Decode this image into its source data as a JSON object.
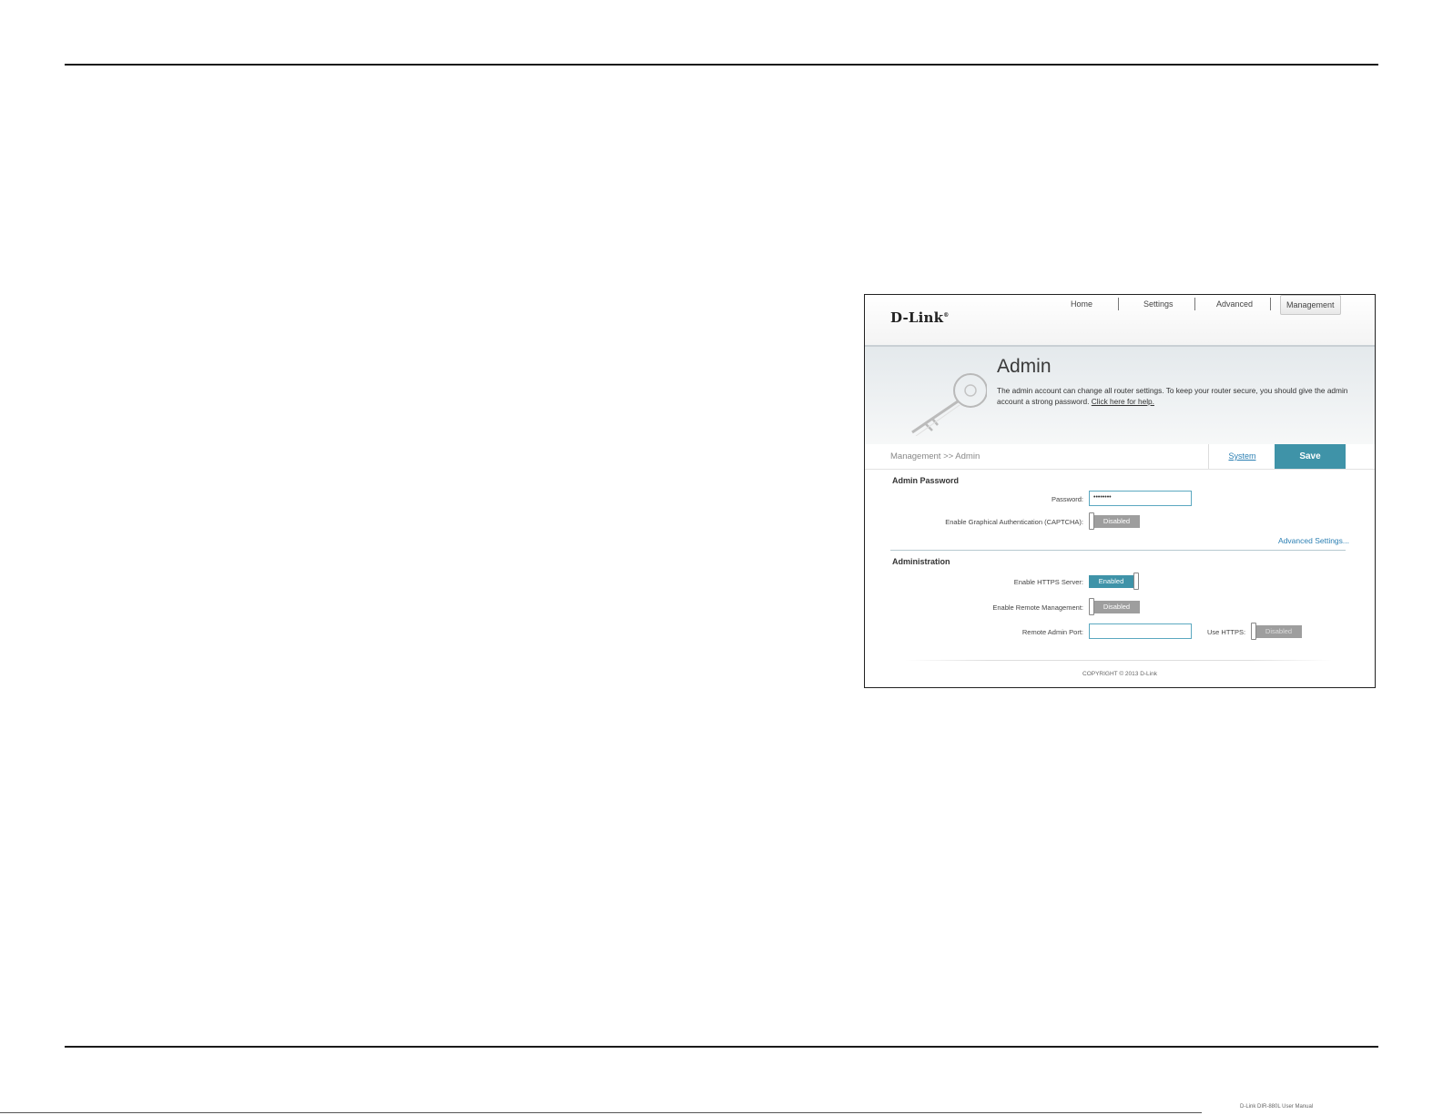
{
  "document": {
    "footer_note": "D-Link DIR-880L User Manual"
  },
  "router_ui": {
    "logo": "D-Link",
    "nav": [
      {
        "label": "Home"
      },
      {
        "label": "Settings"
      },
      {
        "label": "Advanced"
      },
      {
        "label": "Management",
        "active": true
      }
    ],
    "banner": {
      "title": "Admin",
      "description": "The admin account can change all router settings. To keep your router secure, you should give the admin account a strong password.",
      "help_link": "Click here for help."
    },
    "breadcrumb": "Management >> Admin",
    "system_tab": "System",
    "save_button": "Save",
    "admin_password": {
      "title": "Admin Password",
      "password_label": "Password:",
      "password_value": "••••••••",
      "captcha_label": "Enable Graphical Authentication (CAPTCHA):",
      "captcha_state": "Disabled",
      "advanced_link": "Advanced Settings..."
    },
    "administration": {
      "title": "Administration",
      "https_label": "Enable HTTPS Server:",
      "https_state": "Enabled",
      "remote_mgmt_label": "Enable Remote Management:",
      "remote_mgmt_state": "Disabled",
      "remote_port_label": "Remote Admin Port:",
      "remote_port_value": "",
      "use_https_label": "Use HTTPS:",
      "use_https_state": "Disabled"
    },
    "copyright": "COPYRIGHT © 2013 D-Link",
    "colors": {
      "accent": "#3f93a8",
      "disabled": "#9e9e9e",
      "link": "#2b7fb3"
    }
  }
}
